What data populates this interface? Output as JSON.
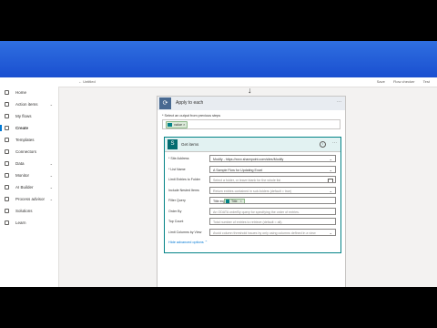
{
  "commandbar": {
    "back_label": "Untitled",
    "actions": [
      "Save",
      "Flow checker",
      "Test"
    ]
  },
  "sidebar": {
    "items": [
      {
        "label": "Home",
        "icon": "home-icon",
        "has_chevron": false
      },
      {
        "label": "Action items",
        "icon": "checklist-icon",
        "has_chevron": true
      },
      {
        "label": "My flows",
        "icon": "flow-icon",
        "has_chevron": false
      },
      {
        "label": "Create",
        "icon": "plus-icon",
        "has_chevron": false,
        "active": true
      },
      {
        "label": "Templates",
        "icon": "template-icon",
        "has_chevron": false
      },
      {
        "label": "Connectors",
        "icon": "connector-icon",
        "has_chevron": false
      },
      {
        "label": "Data",
        "icon": "database-icon",
        "has_chevron": true
      },
      {
        "label": "Monitor",
        "icon": "monitor-icon",
        "has_chevron": true
      },
      {
        "label": "AI Builder",
        "icon": "ai-icon",
        "has_chevron": true
      },
      {
        "label": "Process advisor",
        "icon": "process-icon",
        "has_chevron": true
      },
      {
        "label": "Solutions",
        "icon": "solutions-icon",
        "has_chevron": false
      },
      {
        "label": "Learn",
        "icon": "book-icon",
        "has_chevron": false
      }
    ]
  },
  "apply_to_each": {
    "title": "Apply to each",
    "output_label": "* Select an output from previous steps",
    "output_token": "value"
  },
  "get_items": {
    "title": "Get items",
    "fields": [
      {
        "label": "* Site Address",
        "value": "Modify - https://xxxx.sharepoint.com/sites/Modify",
        "type": "dropdown"
      },
      {
        "label": "* List Name",
        "value": "A Sample Flow for Updating Excel",
        "type": "dropdown"
      },
      {
        "label": "Limit Entries to Folder",
        "value": "Select a folder, or leave blank for the whole list",
        "type": "folder",
        "placeholder": true
      },
      {
        "label": "Include Nested Items",
        "value": "Return entries contained in sub-folders (default = true)",
        "type": "dropdown",
        "placeholder": true
      },
      {
        "label": "Filter Query",
        "value": "Title eq",
        "type": "token",
        "token": "Title"
      },
      {
        "label": "Order By",
        "value": "An ODATA orderBy query for specifying the order of entries.",
        "type": "text",
        "placeholder": true
      },
      {
        "label": "Top Count",
        "value": "Total number of entries to retrieve (default = all).",
        "type": "text",
        "placeholder": true
      },
      {
        "label": "Limit Columns by View",
        "value": "Avoid column threshold issues by only using columns defined in a view",
        "type": "dropdown",
        "placeholder": true
      }
    ],
    "advanced_label": "Hide advanced options"
  },
  "colors": {
    "topbar": "#1a4fd0",
    "accent": "#038387",
    "apply_header": "#486991"
  }
}
